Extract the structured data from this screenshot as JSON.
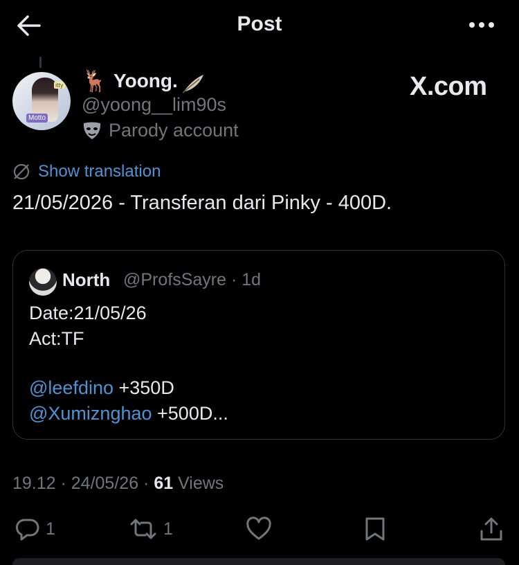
{
  "header": {
    "title": "Post",
    "back_icon": "arrow-left-icon",
    "more_icon": "more-horizontal-icon"
  },
  "author": {
    "emoji_prefix": "🦌",
    "name": "Yoong.",
    "name_suffix_icon": "feather-icon",
    "handle": "@yoong__lim90s",
    "badge_icon": "theater-mask-icon",
    "badge_label": "Parody account",
    "avatar_tags": [
      "Motto",
      "itty"
    ]
  },
  "watermark": "X.com",
  "translation": {
    "icon": "globe-slash-icon",
    "label": "Show translation"
  },
  "post": {
    "text": "21/05/2026 - Transferan dari Pinky - 400D."
  },
  "quote": {
    "name": "North",
    "handle": "@ProfsSayre · 1d",
    "lines": [
      {
        "text": "Date:21/05/26"
      },
      {
        "text": "Act:TF"
      },
      {
        "mention": "@leefdino",
        "text": " +350D"
      },
      {
        "mention": "@Xumiznghao",
        "text": " +500D..."
      }
    ]
  },
  "meta": {
    "time_date": "19.12 · 24/05/26 · ",
    "views_count": "61",
    "views_label": " Views"
  },
  "actions": {
    "reply_count": "1",
    "repost_count": "1",
    "icons": [
      "reply-icon",
      "repost-icon",
      "like-icon",
      "bookmark-icon",
      "share-icon"
    ]
  },
  "colors": {
    "background": "#000000",
    "text": "#e7e9ea",
    "muted": "#71767b",
    "link": "#4f93d6",
    "border": "#2f3336"
  }
}
